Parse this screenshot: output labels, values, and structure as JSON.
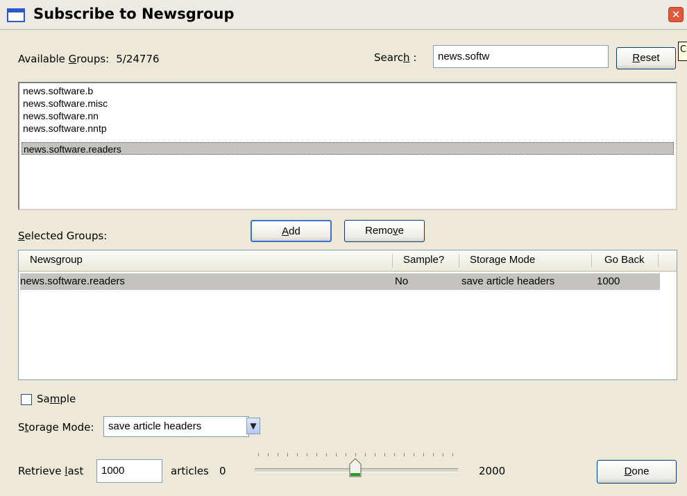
{
  "window": {
    "title": "Subscribe to Newsgroup"
  },
  "available": {
    "label_prefix": "Available ",
    "label_accel": "G",
    "label_suffix": "roups:",
    "count": "5/24776",
    "items": [
      "news.software.b",
      "news.software.misc",
      "news.software.nn",
      "news.software.nntp",
      "news.software.readers"
    ],
    "selected_index": 4
  },
  "search": {
    "label_prefix": "Searc",
    "label_accel": "h",
    "label_suffix": " :",
    "value": "news.softw",
    "reset_accel": "R",
    "reset_suffix": "eset"
  },
  "tooltip_fragment": "C",
  "actions": {
    "add_accel": "A",
    "add_suffix": "dd",
    "remove_prefix": "Remo",
    "remove_accel": "v",
    "remove_suffix": "e"
  },
  "selected": {
    "label_accel": "S",
    "label_suffix": "elected Groups:",
    "columns": [
      "Newsgroup",
      "Sample?",
      "Storage Mode",
      "Go Back"
    ],
    "rows": [
      {
        "newsgroup": "news.software.readers",
        "sample": "No",
        "storage_mode": "save article headers",
        "go_back": "1000"
      }
    ]
  },
  "options": {
    "sample_prefix": "Sa",
    "sample_accel": "m",
    "sample_suffix": "ple",
    "sample_checked": false,
    "storage_prefix": "S",
    "storage_accel": "t",
    "storage_suffix": "orage Mode:",
    "storage_value": "save article headers"
  },
  "retrieve": {
    "label_prefix": "Retrieve ",
    "label_accel": "l",
    "label_suffix": "ast",
    "value": "1000",
    "articles_label": "articles",
    "min_label": "0",
    "max_label": "2000",
    "slider_min": 0,
    "slider_max": 2000,
    "slider_value": 1000
  },
  "done": {
    "accel": "D",
    "suffix": "one"
  },
  "colors": {
    "dialog_bg": "#ece9d8",
    "selection": "#c5c3c0",
    "close_red": "#e0593d",
    "border_blue": "#7f9db9"
  }
}
